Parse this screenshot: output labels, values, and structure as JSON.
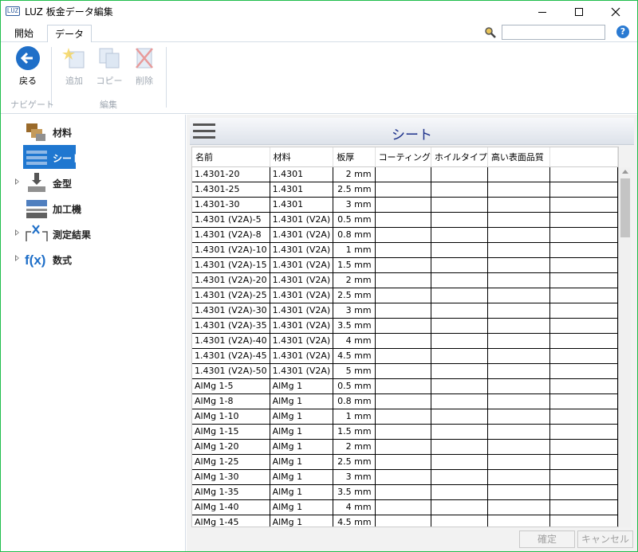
{
  "window": {
    "app_icon_text": "LUZ",
    "title": "LUZ 板金データ編集"
  },
  "ribbon_tabs": [
    {
      "label": "開始",
      "active": false
    },
    {
      "label": "データ",
      "active": true
    }
  ],
  "search": {
    "placeholder": "",
    "value": ""
  },
  "ribbon": {
    "back_label": "戻る",
    "add_label": "追加",
    "copy_label": "コピー",
    "delete_label": "削除",
    "group_nav_label": "ナビゲート",
    "group_edit_label": "編集"
  },
  "sidebar": {
    "items": [
      {
        "label": "材料",
        "icon": "material-icon",
        "expandable": false,
        "selected": false
      },
      {
        "label": "シート",
        "icon": "sheet-icon",
        "expandable": false,
        "selected": true
      },
      {
        "label": "金型",
        "icon": "die-icon",
        "expandable": true,
        "selected": false
      },
      {
        "label": "加工機",
        "icon": "machine-icon",
        "expandable": false,
        "selected": false
      },
      {
        "label": "測定結果",
        "icon": "measurement-icon",
        "expandable": true,
        "selected": false
      },
      {
        "label": "数式",
        "icon": "formula-icon",
        "expandable": true,
        "selected": false
      }
    ]
  },
  "panel": {
    "title": "シート"
  },
  "table": {
    "columns": [
      "名前",
      "材料",
      "板厚",
      "コーティング",
      "ホイルタイプ",
      "高い表面品質"
    ],
    "rows": [
      [
        "1.4301-20",
        "1.4301",
        "2 mm"
      ],
      [
        "1.4301-25",
        "1.4301",
        "2.5 mm"
      ],
      [
        "1.4301-30",
        "1.4301",
        "3 mm"
      ],
      [
        "1.4301 (V2A)-5",
        "1.4301 (V2A)",
        "0.5 mm"
      ],
      [
        "1.4301 (V2A)-8",
        "1.4301 (V2A)",
        "0.8 mm"
      ],
      [
        "1.4301 (V2A)-10",
        "1.4301 (V2A)",
        "1 mm"
      ],
      [
        "1.4301 (V2A)-15",
        "1.4301 (V2A)",
        "1.5 mm"
      ],
      [
        "1.4301 (V2A)-20",
        "1.4301 (V2A)",
        "2 mm"
      ],
      [
        "1.4301 (V2A)-25",
        "1.4301 (V2A)",
        "2.5 mm"
      ],
      [
        "1.4301 (V2A)-30",
        "1.4301 (V2A)",
        "3 mm"
      ],
      [
        "1.4301 (V2A)-35",
        "1.4301 (V2A)",
        "3.5 mm"
      ],
      [
        "1.4301 (V2A)-40",
        "1.4301 (V2A)",
        "4 mm"
      ],
      [
        "1.4301 (V2A)-45",
        "1.4301 (V2A)",
        "4.5 mm"
      ],
      [
        "1.4301 (V2A)-50",
        "1.4301 (V2A)",
        "5 mm"
      ],
      [
        "AlMg 1-5",
        "AlMg 1",
        "0.5 mm"
      ],
      [
        "AlMg 1-8",
        "AlMg 1",
        "0.8 mm"
      ],
      [
        "AlMg 1-10",
        "AlMg 1",
        "1 mm"
      ],
      [
        "AlMg 1-15",
        "AlMg 1",
        "1.5 mm"
      ],
      [
        "AlMg 1-20",
        "AlMg 1",
        "2 mm"
      ],
      [
        "AlMg 1-25",
        "AlMg 1",
        "2.5 mm"
      ],
      [
        "AlMg 1-30",
        "AlMg 1",
        "3 mm"
      ],
      [
        "AlMg 1-35",
        "AlMg 1",
        "3.5 mm"
      ],
      [
        "AlMg 1-40",
        "AlMg 1",
        "4 mm"
      ],
      [
        "AlMg 1-45",
        "AlMg 1",
        "4.5 mm"
      ]
    ]
  },
  "footer": {
    "ok_label": "確定",
    "cancel_label": "キャンセル"
  },
  "colors": {
    "accent": "#1f77d0",
    "title_text": "#1a2f8a",
    "window_border": "#1fbd4c"
  }
}
